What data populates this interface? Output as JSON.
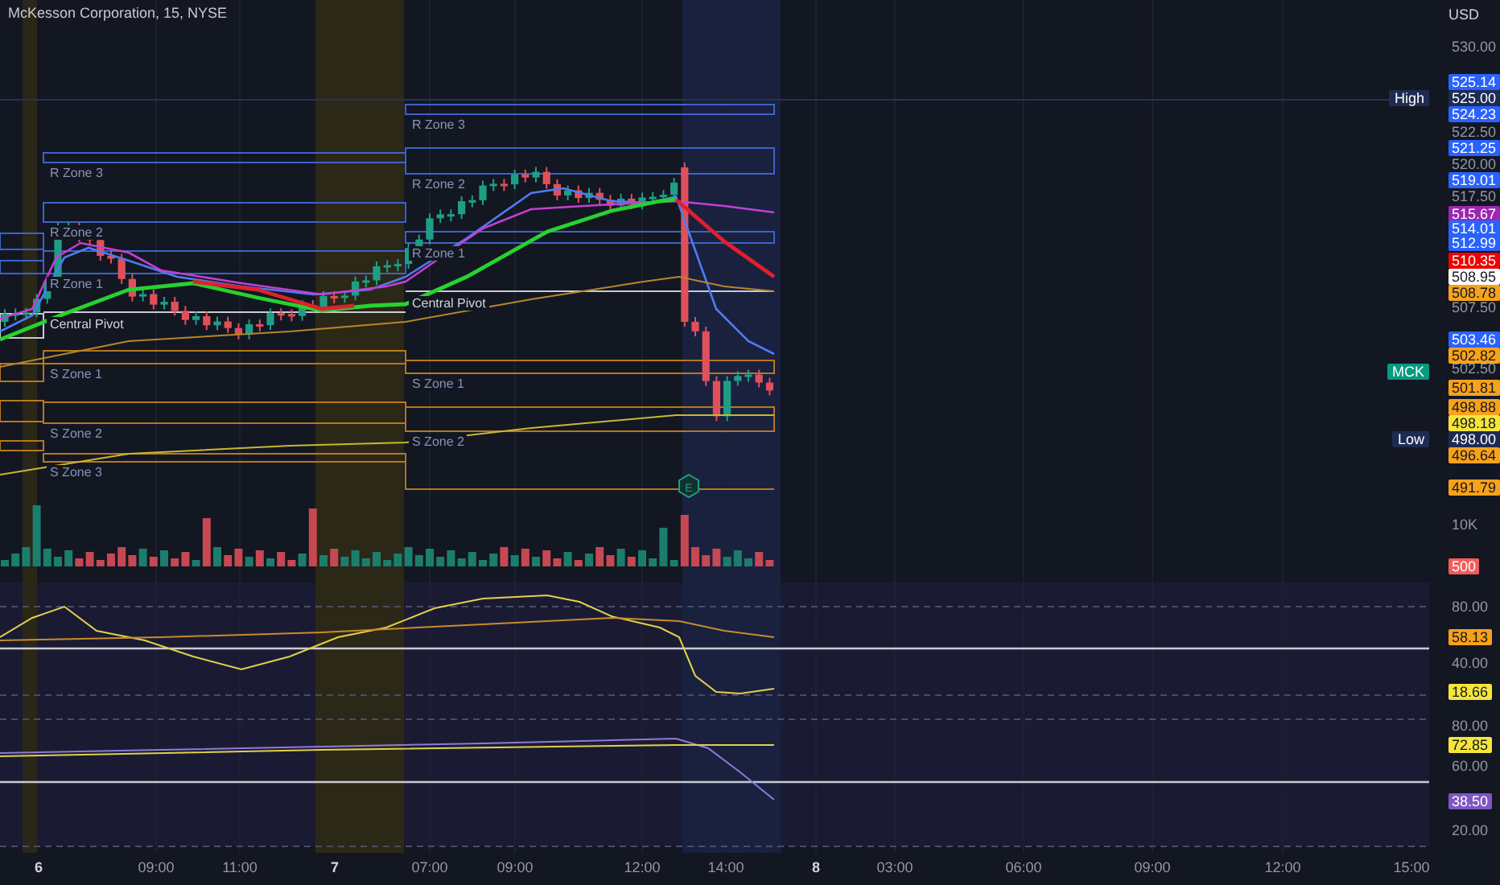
{
  "header": {
    "title": "McKesson Corporation, 15, NYSE",
    "currency": "USD"
  },
  "pivot_sessions": [
    {
      "labels": [
        "R Zone 3",
        "R Zone 2",
        "R Zone 1",
        "Central Pivot",
        "S Zone 1",
        "S Zone 2",
        "S Zone 3"
      ]
    },
    {
      "labels": [
        "R Zone 3",
        "R Zone 2",
        "R Zone 1",
        "Central Pivot",
        "S Zone 1",
        "S Zone 2"
      ]
    }
  ],
  "earnings_marker": {
    "text": "E"
  },
  "price_axis": {
    "ticks": [
      {
        "text": "530.00"
      },
      {
        "text": "522.50"
      },
      {
        "text": "520.00"
      },
      {
        "text": "517.50"
      },
      {
        "text": "507.50"
      },
      {
        "text": "502.50"
      },
      {
        "text": "10K"
      },
      {
        "text": "80.00"
      },
      {
        "text": "40.00"
      },
      {
        "text": "80.00"
      },
      {
        "text": "60.00"
      },
      {
        "text": "20.00"
      }
    ],
    "tags": [
      {
        "text": "525.14",
        "color": "#2962ff"
      },
      {
        "text": "525.00",
        "color": "#1e2b52",
        "side_label": "High"
      },
      {
        "text": "524.23",
        "color": "#2962ff"
      },
      {
        "text": "521.25",
        "color": "#2962ff"
      },
      {
        "text": "519.01",
        "color": "#2962ff"
      },
      {
        "text": "515.67",
        "color": "#9c27b0"
      },
      {
        "text": "514.01",
        "color": "#2962ff"
      },
      {
        "text": "512.99",
        "color": "#2962ff"
      },
      {
        "text": "510.35",
        "color": "#f00000"
      },
      {
        "text": "508.95",
        "color": "#ffffff"
      },
      {
        "text": "508.78",
        "color": "#f7a21b"
      },
      {
        "text": "503.46",
        "color": "#2962ff"
      },
      {
        "text": "502.82",
        "color": "#f7a21b"
      },
      {
        "text": "501.81",
        "color": "#f7a21b"
      },
      {
        "text": "498.88",
        "color": "#f7a21b"
      },
      {
        "text": "498.18",
        "color": "#f5e53b"
      },
      {
        "text": "498.00",
        "color": "#1e2b52",
        "side_label": "Low"
      },
      {
        "text": "496.64",
        "color": "#f7a21b"
      },
      {
        "text": "491.79",
        "color": "#f7a21b"
      },
      {
        "text": "500",
        "color": "#f25c5c"
      },
      {
        "text": "58.13",
        "color": "#f7a21b"
      },
      {
        "text": "18.66",
        "color": "#f5e53b"
      },
      {
        "text": "72.85",
        "color": "#f5e53b"
      },
      {
        "text": "38.50",
        "color": "#7e57c2"
      }
    ]
  },
  "symbol_tag": {
    "text": "MCK",
    "color": "#089981"
  },
  "time_axis": {
    "labels": [
      {
        "text": "6",
        "kind": "day"
      },
      {
        "text": "09:00",
        "kind": "time"
      },
      {
        "text": "11:00",
        "kind": "time"
      },
      {
        "text": "7",
        "kind": "day"
      },
      {
        "text": "07:00",
        "kind": "time"
      },
      {
        "text": "09:00",
        "kind": "time"
      },
      {
        "text": "12:00",
        "kind": "time"
      },
      {
        "text": "14:00",
        "kind": "time"
      },
      {
        "text": "8",
        "kind": "day"
      },
      {
        "text": "03:00",
        "kind": "time"
      },
      {
        "text": "06:00",
        "kind": "time"
      },
      {
        "text": "09:00",
        "kind": "time"
      },
      {
        "text": "12:00",
        "kind": "time"
      },
      {
        "text": "15:00",
        "kind": "time"
      }
    ]
  }
}
